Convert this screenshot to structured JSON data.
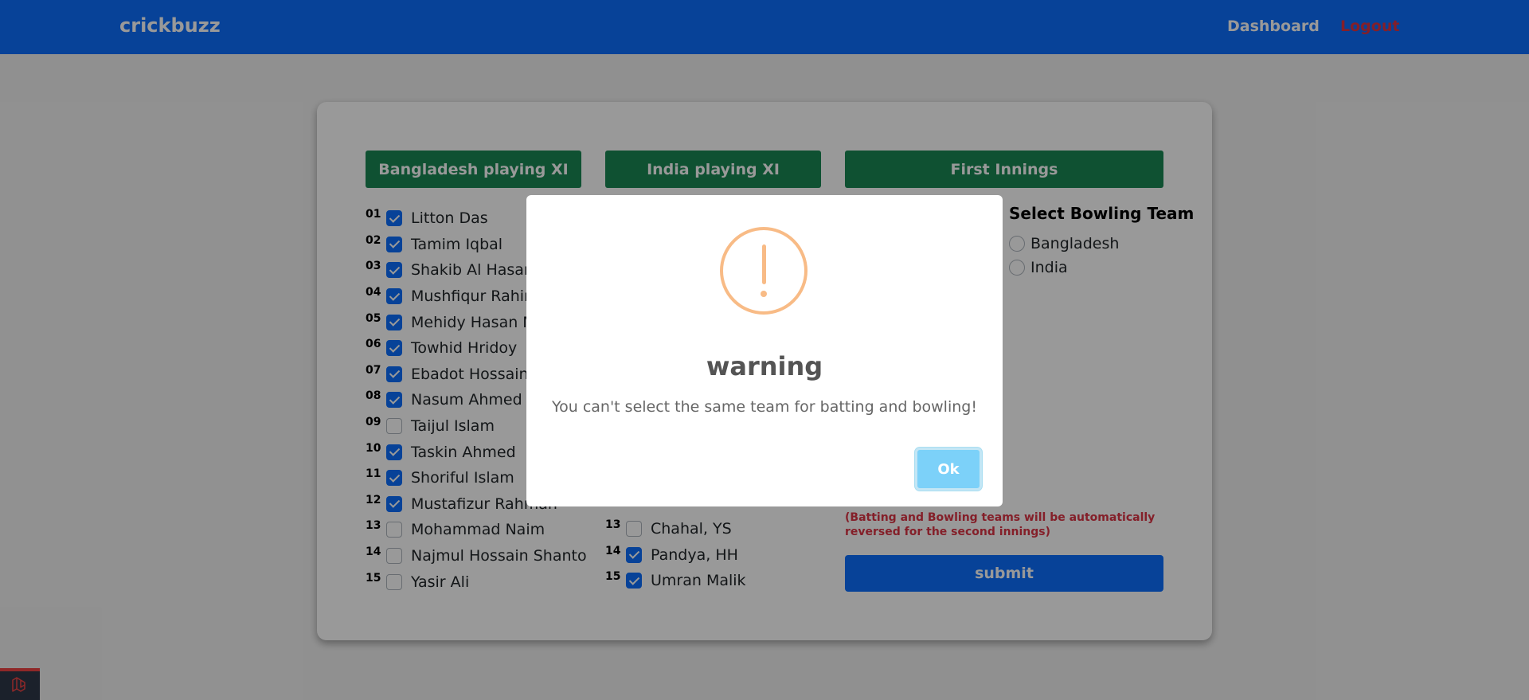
{
  "navbar": {
    "brand": "crickbuzz",
    "dashboard": "Dashboard",
    "logout": "Logout"
  },
  "sections": {
    "bangladesh": "Bangladesh playing XI",
    "india": "India playing XI",
    "innings": "First Innings"
  },
  "bangladesh_players": [
    {
      "num": "01",
      "name": "Litton Das",
      "checked": true
    },
    {
      "num": "02",
      "name": "Tamim Iqbal",
      "checked": true
    },
    {
      "num": "03",
      "name": "Shakib Al Hasan",
      "checked": true
    },
    {
      "num": "04",
      "name": "Mushfiqur Rahim",
      "checked": true
    },
    {
      "num": "05",
      "name": "Mehidy Hasan M",
      "checked": true
    },
    {
      "num": "06",
      "name": "Towhid Hridoy",
      "checked": true
    },
    {
      "num": "07",
      "name": "Ebadot Hossain",
      "checked": true
    },
    {
      "num": "08",
      "name": "Nasum Ahmed",
      "checked": true
    },
    {
      "num": "09",
      "name": "Taijul Islam",
      "checked": false
    },
    {
      "num": "10",
      "name": "Taskin Ahmed",
      "checked": true
    },
    {
      "num": "11",
      "name": "Shoriful Islam",
      "checked": true
    },
    {
      "num": "12",
      "name": "Mustafizur Rahman",
      "checked": true
    },
    {
      "num": "13",
      "name": "Mohammad Naim",
      "checked": false
    },
    {
      "num": "14",
      "name": "Najmul Hossain Shanto",
      "checked": false
    },
    {
      "num": "15",
      "name": "Yasir Ali",
      "checked": false
    }
  ],
  "india_players": [
    {
      "num": "13",
      "name": "Chahal, YS",
      "checked": false
    },
    {
      "num": "14",
      "name": "Pandya, HH",
      "checked": true
    },
    {
      "num": "15",
      "name": "Umran Malik",
      "checked": true
    }
  ],
  "bowling": {
    "title": "Select Bowling Team",
    "options": [
      "Bangladesh",
      "India"
    ]
  },
  "note": "(Batting and Bowling teams will be automatically reversed for the second innings)",
  "submit": "submit",
  "modal": {
    "title": "warning",
    "text": "You can't select the same team for batting and bowling!",
    "ok": "Ok"
  },
  "colors": {
    "primary": "#0d6efd",
    "success": "#198754",
    "danger": "#dc3545",
    "warning_icon": "#f8bb86",
    "ok_button": "#7cd1f9"
  }
}
